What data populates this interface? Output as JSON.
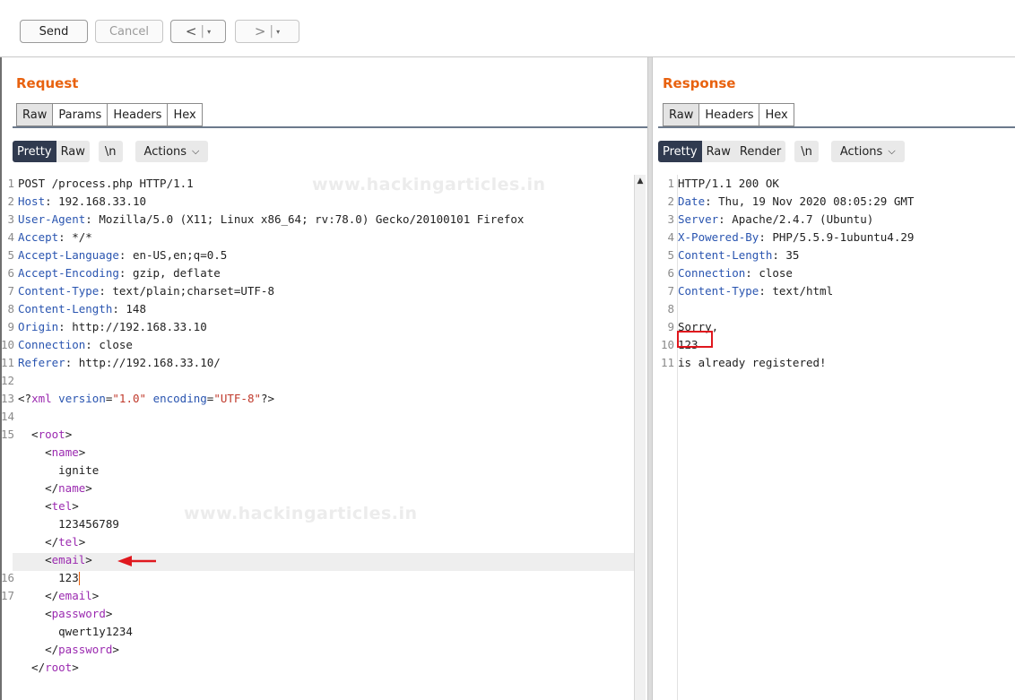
{
  "toolbar": {
    "send": "Send",
    "cancel": "Cancel",
    "back": "<",
    "forward": ">",
    "drop": "▾",
    "sep": "|"
  },
  "request": {
    "title": "Request",
    "tabs": [
      "Raw",
      "Params",
      "Headers",
      "Hex"
    ],
    "active_tab": "Raw",
    "view_modes": [
      "Pretty",
      "Raw"
    ],
    "newline_toggle": "\\n",
    "actions": "Actions",
    "lines": [
      {
        "n": "1",
        "parts": [
          [
            "t",
            "POST /process.php HTTP/1.1"
          ]
        ]
      },
      {
        "n": "2",
        "parts": [
          [
            "k",
            "Host"
          ],
          [
            "t",
            ": 192.168.33.10"
          ]
        ]
      },
      {
        "n": "3",
        "parts": [
          [
            "k",
            "User-Agent"
          ],
          [
            "t",
            ": Mozilla/5.0 (X11; Linux x86_64; rv:78.0) Gecko/20100101 Firefox"
          ]
        ]
      },
      {
        "n": "4",
        "parts": [
          [
            "k",
            "Accept"
          ],
          [
            "t",
            ": */*"
          ]
        ]
      },
      {
        "n": "5",
        "parts": [
          [
            "k",
            "Accept-Language"
          ],
          [
            "t",
            ": en-US,en;q=0.5"
          ]
        ]
      },
      {
        "n": "6",
        "parts": [
          [
            "k",
            "Accept-Encoding"
          ],
          [
            "t",
            ": gzip, deflate"
          ]
        ]
      },
      {
        "n": "7",
        "parts": [
          [
            "k",
            "Content-Type"
          ],
          [
            "t",
            ": text/plain;charset=UTF-8"
          ]
        ]
      },
      {
        "n": "8",
        "parts": [
          [
            "k",
            "Content-Length"
          ],
          [
            "t",
            ": 148"
          ]
        ]
      },
      {
        "n": "9",
        "parts": [
          [
            "k",
            "Origin"
          ],
          [
            "t",
            ": http://192.168.33.10"
          ]
        ]
      },
      {
        "n": "10",
        "parts": [
          [
            "k",
            "Connection"
          ],
          [
            "t",
            ": close"
          ]
        ]
      },
      {
        "n": "11",
        "parts": [
          [
            "k",
            "Referer"
          ],
          [
            "t",
            ": http://192.168.33.10/"
          ]
        ]
      },
      {
        "n": "12",
        "parts": []
      },
      {
        "n": "13",
        "parts": [
          [
            "t",
            "<?"
          ],
          [
            "g",
            "xml"
          ],
          [
            "t",
            " "
          ],
          [
            "k",
            "version"
          ],
          [
            "t",
            "="
          ],
          [
            "s",
            "\"1.0\""
          ],
          [
            "t",
            " "
          ],
          [
            "k",
            "encoding"
          ],
          [
            "t",
            "="
          ],
          [
            "s",
            "\"UTF-8\""
          ],
          [
            "t",
            "?>"
          ]
        ]
      },
      {
        "n": "14",
        "parts": []
      },
      {
        "n": "15",
        "parts": [
          [
            "t",
            "  <"
          ],
          [
            "g",
            "root"
          ],
          [
            "t",
            ">"
          ]
        ]
      },
      {
        "n": "",
        "parts": [
          [
            "t",
            "    <"
          ],
          [
            "g",
            "name"
          ],
          [
            "t",
            ">"
          ]
        ]
      },
      {
        "n": "",
        "parts": [
          [
            "t",
            "      ignite"
          ]
        ]
      },
      {
        "n": "",
        "parts": [
          [
            "t",
            "    </"
          ],
          [
            "g",
            "name"
          ],
          [
            "t",
            ">"
          ]
        ]
      },
      {
        "n": "",
        "parts": [
          [
            "t",
            "    <"
          ],
          [
            "g",
            "tel"
          ],
          [
            "t",
            ">"
          ]
        ]
      },
      {
        "n": "",
        "parts": [
          [
            "t",
            "      123456789"
          ]
        ]
      },
      {
        "n": "",
        "parts": [
          [
            "t",
            "    </"
          ],
          [
            "g",
            "tel"
          ],
          [
            "t",
            ">"
          ]
        ]
      },
      {
        "n": "",
        "parts": [
          [
            "t",
            "    <"
          ],
          [
            "g",
            "email"
          ],
          [
            "t",
            ">"
          ]
        ]
      },
      {
        "n": "16",
        "parts": [
          [
            "t",
            "      123"
          ]
        ],
        "caret": true
      },
      {
        "n": "17",
        "parts": [
          [
            "t",
            "    </"
          ],
          [
            "g",
            "email"
          ],
          [
            "t",
            ">"
          ]
        ]
      },
      {
        "n": "",
        "parts": [
          [
            "t",
            "    <"
          ],
          [
            "g",
            "password"
          ],
          [
            "t",
            ">"
          ]
        ]
      },
      {
        "n": "",
        "parts": [
          [
            "t",
            "      qwert1y1234"
          ]
        ]
      },
      {
        "n": "",
        "parts": [
          [
            "t",
            "    </"
          ],
          [
            "g",
            "password"
          ],
          [
            "t",
            ">"
          ]
        ]
      },
      {
        "n": "",
        "parts": [
          [
            "t",
            "  </"
          ],
          [
            "g",
            "root"
          ],
          [
            "t",
            ">"
          ]
        ]
      }
    ]
  },
  "response": {
    "title": "Response",
    "tabs": [
      "Raw",
      "Headers",
      "Hex"
    ],
    "active_tab": "Raw",
    "view_modes": [
      "Pretty",
      "Raw",
      "Render"
    ],
    "newline_toggle": "\\n",
    "actions": "Actions",
    "lines": [
      {
        "n": "1",
        "parts": [
          [
            "t",
            "HTTP/1.1 200 OK"
          ]
        ]
      },
      {
        "n": "2",
        "parts": [
          [
            "k",
            "Date"
          ],
          [
            "t",
            ": Thu, 19 Nov 2020 08:05:29 GMT"
          ]
        ]
      },
      {
        "n": "3",
        "parts": [
          [
            "k",
            "Server"
          ],
          [
            "t",
            ": Apache/2.4.7 (Ubuntu)"
          ]
        ]
      },
      {
        "n": "4",
        "parts": [
          [
            "k",
            "X-Powered-By"
          ],
          [
            "t",
            ": PHP/5.5.9-1ubuntu4.29"
          ]
        ]
      },
      {
        "n": "5",
        "parts": [
          [
            "k",
            "Content-Length"
          ],
          [
            "t",
            ": 35"
          ]
        ]
      },
      {
        "n": "6",
        "parts": [
          [
            "k",
            "Connection"
          ],
          [
            "t",
            ": close"
          ]
        ]
      },
      {
        "n": "7",
        "parts": [
          [
            "k",
            "Content-Type"
          ],
          [
            "t",
            ": text/html"
          ]
        ]
      },
      {
        "n": "8",
        "parts": []
      },
      {
        "n": "9",
        "parts": [
          [
            "t",
            "Sorry,"
          ]
        ]
      },
      {
        "n": "10",
        "parts": [
          [
            "t",
            "123"
          ]
        ]
      },
      {
        "n": "11",
        "parts": [
          [
            "t",
            "is already registered!"
          ]
        ]
      }
    ]
  },
  "watermark": "www.hackingarticles.in",
  "colors": {
    "accent": "#e8620f",
    "header_key": "#2a55b0",
    "xml_tag": "#9b2ab0",
    "xml_string": "#c0392b",
    "highlight_box": "#e0181e"
  }
}
